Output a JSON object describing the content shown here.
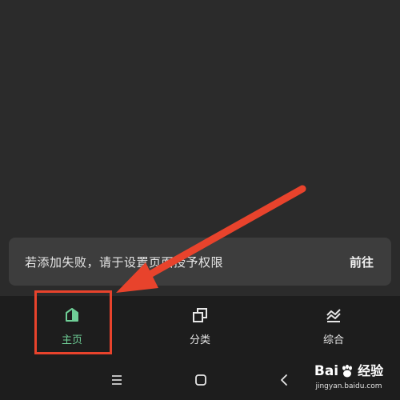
{
  "toast": {
    "message": "若添加失败，请于设置页面授予权限",
    "action": "前往"
  },
  "tabs": [
    {
      "label": "主页",
      "icon": "home-icon",
      "active": true
    },
    {
      "label": "分类",
      "icon": "category-icon",
      "active": false
    },
    {
      "label": "综合",
      "icon": "chart-icon",
      "active": false
    }
  ],
  "nav": {
    "menu_icon": "menu-icon",
    "home_icon": "home-square-icon",
    "back_icon": "back-icon"
  },
  "watermark": {
    "brand_left": "Bai",
    "brand_right": "经验",
    "url": "jingyan.baidu.com"
  },
  "colors": {
    "accent": "#6fcf97",
    "annotation": "#e8432c",
    "background": "#2b2b2b",
    "toast": "#3d3d3d",
    "tabbar": "#1d1d1d"
  }
}
